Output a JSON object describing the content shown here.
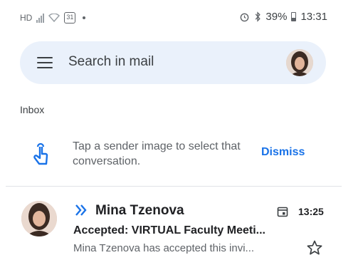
{
  "status_bar": {
    "network_label": "HD",
    "calendar_day": "31",
    "battery_percent": "39%",
    "time": "13:31",
    "icons": [
      "signal-icon",
      "wifi-icon",
      "calendar-notification-icon",
      "alarm-icon",
      "bluetooth-icon",
      "battery-icon"
    ]
  },
  "search": {
    "placeholder": "Search in mail",
    "icons": [
      "menu-icon",
      "account-avatar"
    ]
  },
  "mailbox": {
    "label": "Inbox"
  },
  "tip": {
    "text": "Tap a sender image to select that conversation.",
    "dismiss_label": "Dismiss",
    "icon": "tap-gesture-icon"
  },
  "emails": [
    {
      "sender": "Mina Tzenova",
      "time": "13:25",
      "subject": "Accepted: VIRTUAL Faculty Meeti...",
      "snippet": "Mina Tzenova has accepted this invi...",
      "important": true,
      "has_calendar_invite": true,
      "starred": false
    }
  ],
  "colors": {
    "accent": "#1a73e8",
    "search_bg": "#eaf1fb",
    "text_primary": "#202124",
    "text_secondary": "#5f6368"
  }
}
